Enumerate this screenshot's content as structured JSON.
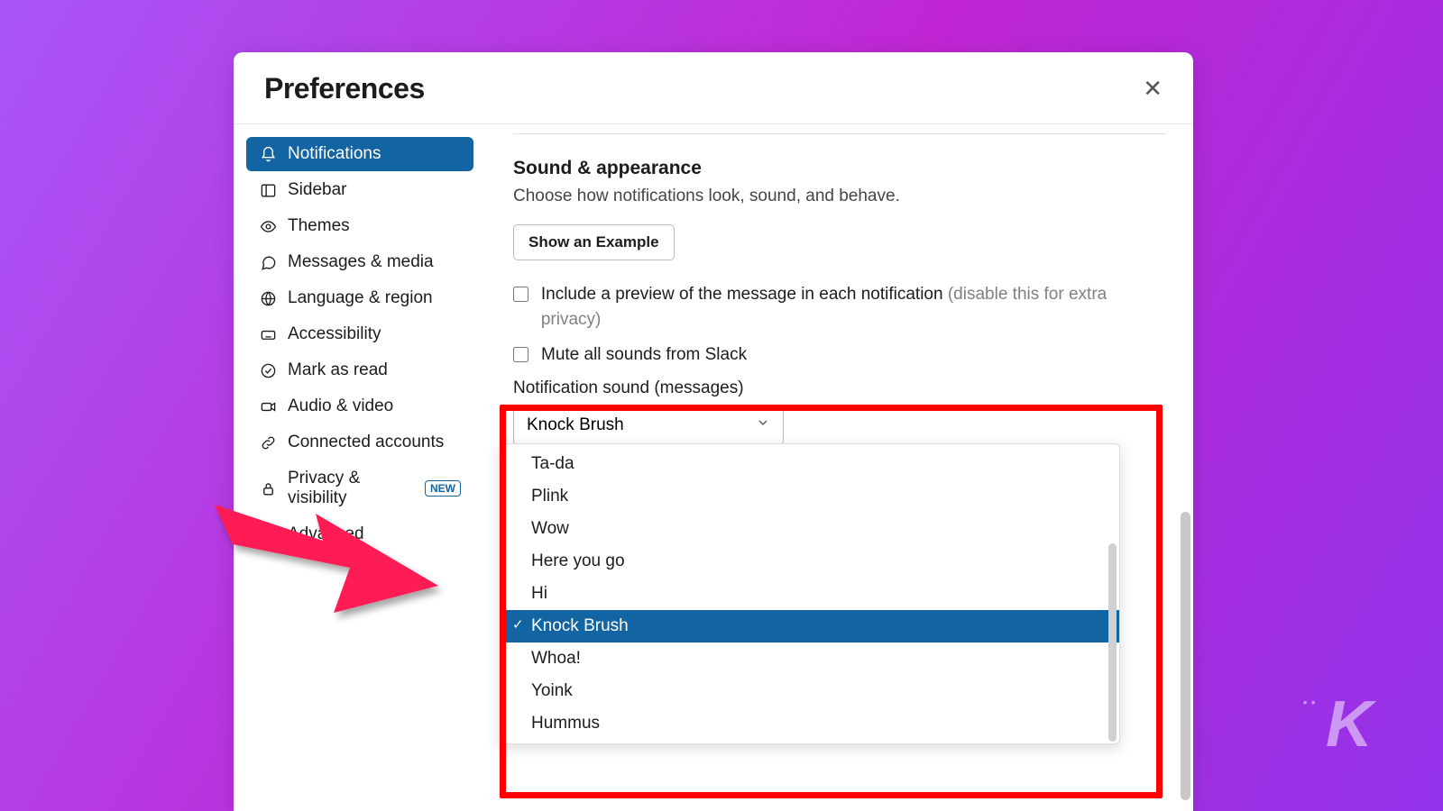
{
  "window": {
    "title": "Preferences"
  },
  "sidebar": {
    "items": [
      {
        "label": "Notifications",
        "active": true
      },
      {
        "label": "Sidebar"
      },
      {
        "label": "Themes"
      },
      {
        "label": "Messages & media"
      },
      {
        "label": "Language & region"
      },
      {
        "label": "Accessibility"
      },
      {
        "label": "Mark as read"
      },
      {
        "label": "Audio & video"
      },
      {
        "label": "Connected accounts"
      },
      {
        "label": "Privacy & visibility",
        "badge": "NEW"
      },
      {
        "label": "Advanced"
      }
    ]
  },
  "main": {
    "section_title": "Sound & appearance",
    "section_sub": "Choose how notifications look, sound, and behave.",
    "example_btn": "Show an Example",
    "check1": "Include a preview of the message in each notification ",
    "check1_muted": "(disable this for extra privacy)",
    "check2": "Mute all sounds from Slack",
    "sound_label": "Notification sound (messages)",
    "sound_selected": "Knock Brush",
    "options": [
      "Ta-da",
      "Plink",
      "Wow",
      "Here you go",
      "Hi",
      "Knock Brush",
      "Whoa!",
      "Yoink",
      "Hummus"
    ]
  }
}
